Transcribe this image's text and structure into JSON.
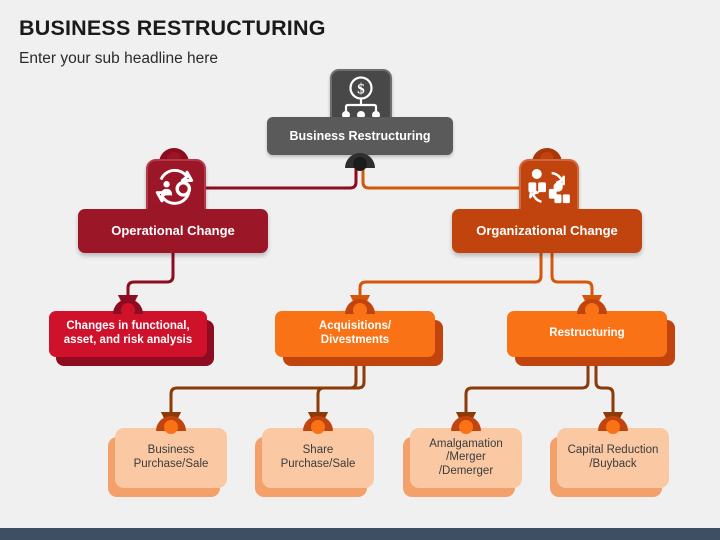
{
  "header": {
    "title": "BUSINESS RESTRUCTURING",
    "subtitle": "Enter your sub headline here"
  },
  "colors": {
    "background": "#f0f0f0",
    "footer_bar": "#3e4e63",
    "root_gray": "#5a5a5a",
    "maroon": "#9b1626",
    "red": "#d0112b",
    "burnt_orange": "#c1440e",
    "orange": "#f97316",
    "peach": "#fac9a4",
    "peach_shadow": "#f4a06a",
    "wire_maroon": "#8d0c1f",
    "wire_orange": "#d4570c",
    "wire_brown": "#8b3a08"
  },
  "diagram": {
    "root": {
      "label": "Business Restructuring",
      "icon": "dollar-coin-hierarchy-icon"
    },
    "branches": [
      {
        "id": "operational",
        "label": "Operational Change",
        "icon": "cycle-person-gear-icon",
        "children": [
          {
            "id": "changes-analysis",
            "label": "Changes in functional, asset, and risk analysis",
            "line1": "Changes in functional,",
            "line2": "asset, and risk analysis",
            "children": []
          }
        ]
      },
      {
        "id": "organizational",
        "label": "Organizational Change",
        "icon": "org-chart-rotate-icon",
        "children": [
          {
            "id": "acquisitions",
            "label": "Acquisitions/ Divestments",
            "line1": "Acquisitions/",
            "line2": "Divestments",
            "children": [
              {
                "id": "business-purchase-sale",
                "line1": "Business",
                "line2": "Purchase/Sale",
                "line3": ""
              },
              {
                "id": "share-purchase-sale",
                "line1": "Share",
                "line2": "Purchase/Sale",
                "line3": ""
              }
            ]
          },
          {
            "id": "restructuring",
            "label": "Restructuring",
            "line1": "Restructuring",
            "line2": "",
            "children": [
              {
                "id": "amalgamation-merger-demerger",
                "line1": "Amalgamation",
                "line2": "/Merger",
                "line3": "/Demerger"
              },
              {
                "id": "capital-reduction-buyback",
                "line1": "Capital Reduction",
                "line2": "/Buyback",
                "line3": ""
              }
            ]
          }
        ]
      }
    ]
  }
}
